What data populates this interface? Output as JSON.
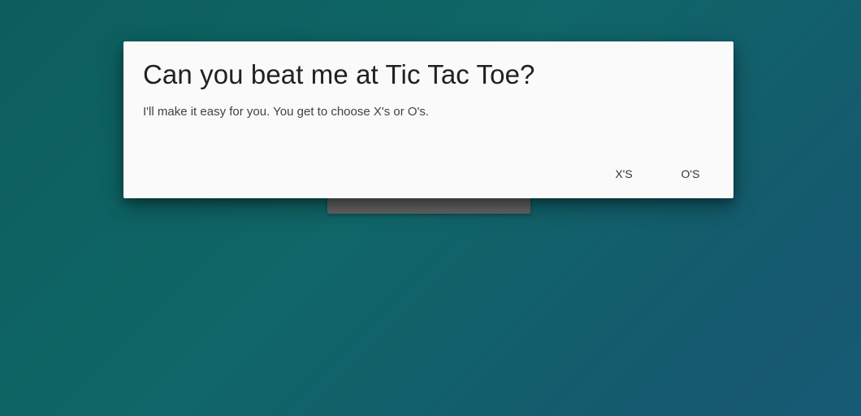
{
  "dialog": {
    "title": "Can you beat me at Tic Tac Toe?",
    "message": "I'll make it easy for you. You get to choose X's or O's.",
    "actions": {
      "x_label": "X'S",
      "o_label": "O'S"
    }
  },
  "colors": {
    "background_start": "#0c5e5c",
    "background_end": "#175a75",
    "dialog_surface": "#fafafa",
    "board": "#646464"
  }
}
